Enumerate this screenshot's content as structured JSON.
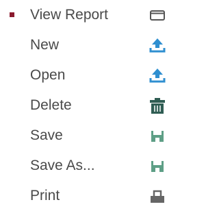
{
  "menu": {
    "items": [
      {
        "label": "View Report",
        "icon": "window-icon",
        "selected": true
      },
      {
        "label": "New",
        "icon": "upload-icon",
        "selected": false
      },
      {
        "label": "Open",
        "icon": "upload-icon",
        "selected": false
      },
      {
        "label": "Delete",
        "icon": "trash-icon",
        "selected": false
      },
      {
        "label": "Save",
        "icon": "floppy-icon",
        "selected": false
      },
      {
        "label": "Save As...",
        "icon": "floppy-icon",
        "selected": false
      },
      {
        "label": "Print",
        "icon": "printer-icon",
        "selected": false
      }
    ]
  },
  "colors": {
    "marker": "#8b1a2e",
    "text": "#4a4a4a",
    "upload": "#2f8fd0",
    "trash": "#2f5d53",
    "save": "#5e9f86",
    "print": "#666666",
    "window": "#555555"
  }
}
